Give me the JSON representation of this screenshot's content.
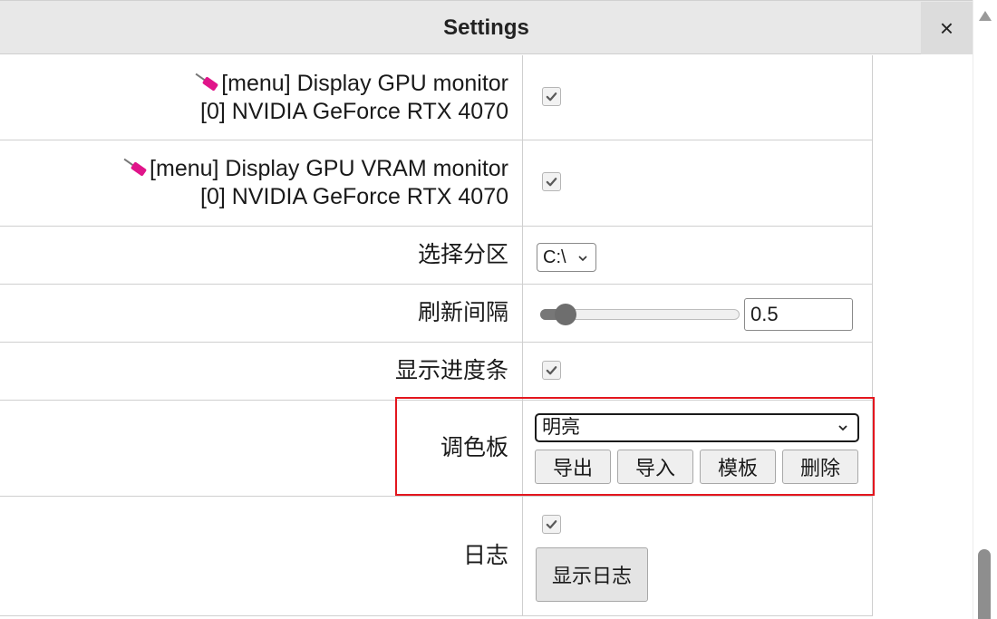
{
  "window": {
    "title": "Settings",
    "close_label": "×"
  },
  "settings": {
    "gpu_monitor": {
      "line1": "[menu] Display GPU monitor",
      "line2": "[0] NVIDIA GeForce RTX 4070",
      "checked": true,
      "icon": "plug-icon"
    },
    "vram_monitor": {
      "line1": "[menu] Display GPU VRAM monitor",
      "line2": "[0] NVIDIA GeForce RTX 4070",
      "checked": true,
      "icon": "plug-icon"
    },
    "partition": {
      "label": "选择分区",
      "value": "C:\\"
    },
    "refresh_interval": {
      "label": "刷新间隔",
      "value": "0.5",
      "slider_fraction": 0.05
    },
    "progress_bar": {
      "label": "显示进度条",
      "checked": true
    },
    "palette": {
      "label": "调色板",
      "value": "明亮",
      "buttons": {
        "export": "导出",
        "import": "导入",
        "template": "模板",
        "delete": "删除"
      }
    },
    "log": {
      "label": "日志",
      "checked": true,
      "show_button": "显示日志"
    }
  },
  "colors": {
    "highlight": "#e3161e",
    "plug": "#e0158a"
  }
}
